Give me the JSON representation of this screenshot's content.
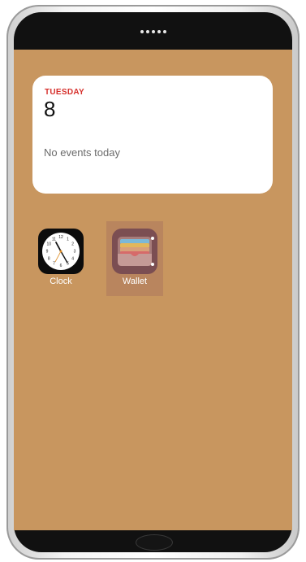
{
  "calendar_widget": {
    "weekday": "TUESDAY",
    "day": "8",
    "message": "No events today"
  },
  "apps": [
    {
      "label": "Clock",
      "icon": "clock-icon",
      "selected": false
    },
    {
      "label": "Wallet",
      "icon": "wallet-icon",
      "selected": true
    }
  ],
  "colors": {
    "wallpaper": "#c8965f",
    "selection": "#b9855e",
    "weekday_red": "#d6302c"
  }
}
